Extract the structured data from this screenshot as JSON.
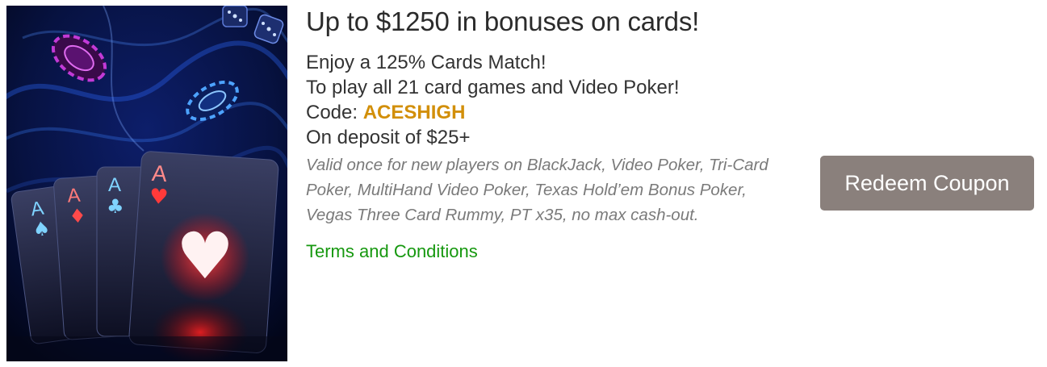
{
  "offer": {
    "headline": "Up to $1250 in bonuses on cards!",
    "line_1": "Enjoy a 125% Cards Match!",
    "line_2": "To play all 21 card games and Video Poker!",
    "code_label": "Code: ",
    "code_value": "ACESHIGH",
    "deposit": "On deposit of $25+",
    "fine_print": "Valid once for new players on BlackJack, Video Poker, Tri-Card Poker, MultiHand Video Poker, Texas Hold’em Bonus Poker, Vegas Three Card Rummy, PT x35, no max cash-out.",
    "terms_link": "Terms and Conditions",
    "redeem_button": "Redeem Coupon"
  },
  "image": {
    "icon": "four-aces-poker-chips-illustration",
    "card_ranks": [
      "A",
      "A",
      "A",
      "A"
    ],
    "card_suits": [
      "♠",
      "♦",
      "♣",
      "♥"
    ]
  },
  "colors": {
    "code_accent": "#d28f09",
    "link": "#16980f",
    "button_bg": "#8a807c",
    "headline_text": "#2b2b2b",
    "fine_print_text": "#7a7a7a"
  }
}
